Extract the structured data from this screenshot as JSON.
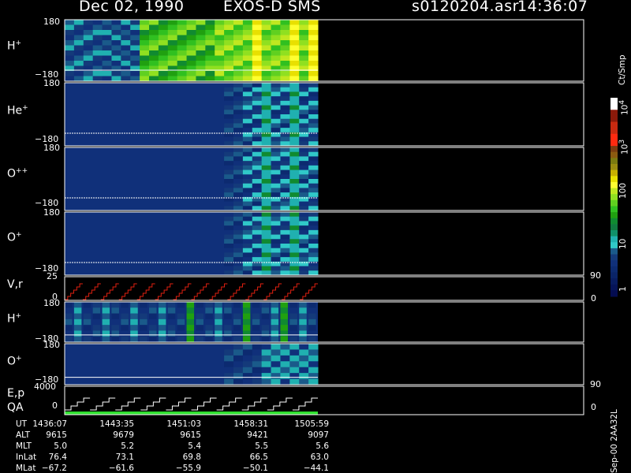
{
  "header": {
    "date": "Dec 02, 1990",
    "instrument": "EXOS-D SMS",
    "file": "s0120204.asr",
    "time": "14:36:07"
  },
  "panels": [
    {
      "species": "H",
      "charge": "+",
      "top_tick": "180",
      "bottom_tick": "−180"
    },
    {
      "species": "He",
      "charge": "+",
      "top_tick": "180",
      "bottom_tick": "−180"
    },
    {
      "species": "O",
      "charge": "++",
      "top_tick": "180",
      "bottom_tick": "−180"
    },
    {
      "species": "O",
      "charge": "+",
      "top_tick": "180",
      "bottom_tick": "−180"
    },
    {
      "species": "V,r",
      "charge": "",
      "top_tick": "25",
      "bottom_tick": "0",
      "right_top": "90",
      "right_bottom": "0"
    },
    {
      "species": "H",
      "charge": "+",
      "top_tick": "180",
      "bottom_tick": "−180"
    },
    {
      "species": "O",
      "charge": "+",
      "top_tick": "180",
      "bottom_tick": "−180",
      "right_bottom": "90"
    },
    {
      "species": "E,p",
      "species2": "QA",
      "charge": "",
      "top_tick": "4000",
      "bottom_tick": "0",
      "right_bottom": "0"
    }
  ],
  "colorbar": {
    "unit": "Ct/Smp",
    "labels": [
      "10",
      "4",
      "10",
      "3",
      "100",
      "10",
      "1"
    ],
    "colors": [
      "#ffffff",
      "#ffffff",
      "#8b1a0a",
      "#8b1a0a",
      "#c82a10",
      "#c82a10",
      "#ff2a10",
      "#ff2a10",
      "#7a3b10",
      "#8b5a10",
      "#7a7a10",
      "#9a8c10",
      "#c8b000",
      "#e8e000",
      "#ffff30",
      "#c0e820",
      "#90e020",
      "#60d020",
      "#30c020",
      "#20a010",
      "#108a30",
      "#107a40",
      "#10906a",
      "#20b0b0",
      "#30c8c8",
      "#1a5a8a",
      "#143a7a",
      "#10307a",
      "#0c2a70",
      "#0a2468",
      "#081c60",
      "#061458",
      "#040c50"
    ]
  },
  "footer": {
    "row_labels": [
      "UT",
      "ALT",
      "MLT",
      "InLat",
      "MLat"
    ],
    "columns": [
      [
        "1436:07",
        "9615",
        "5.0",
        "76.4",
        "−67.2"
      ],
      [
        "1443:35",
        "9679",
        "5.2",
        "73.1",
        "−61.6"
      ],
      [
        "1451:03",
        "9615",
        "5.4",
        "69.8",
        "−55.9"
      ],
      [
        "1458:31",
        "9421",
        "5.5",
        "66.5",
        "−50.1"
      ],
      [
        "1505:59",
        "9097",
        "5.6",
        "63.0",
        "−44.1"
      ]
    ],
    "version": "Sep-00  2AA32L"
  },
  "chart_data": {
    "type": "heatmap",
    "title": "Dec 02, 1990    EXOS-D SMS",
    "x": [
      "1436:07",
      "1443:35",
      "1451:03",
      "1458:31",
      "1505:59"
    ],
    "panels": [
      "H+",
      "He+",
      "O++",
      "O+",
      "V,r",
      "H+",
      "O+",
      "E,p / QA"
    ],
    "ylim": [
      -180,
      180
    ],
    "colorbar_unit": "Ct/Smp",
    "colorbar_ticks": [
      "10^4",
      "10^3",
      "100",
      "10",
      "1"
    ]
  }
}
